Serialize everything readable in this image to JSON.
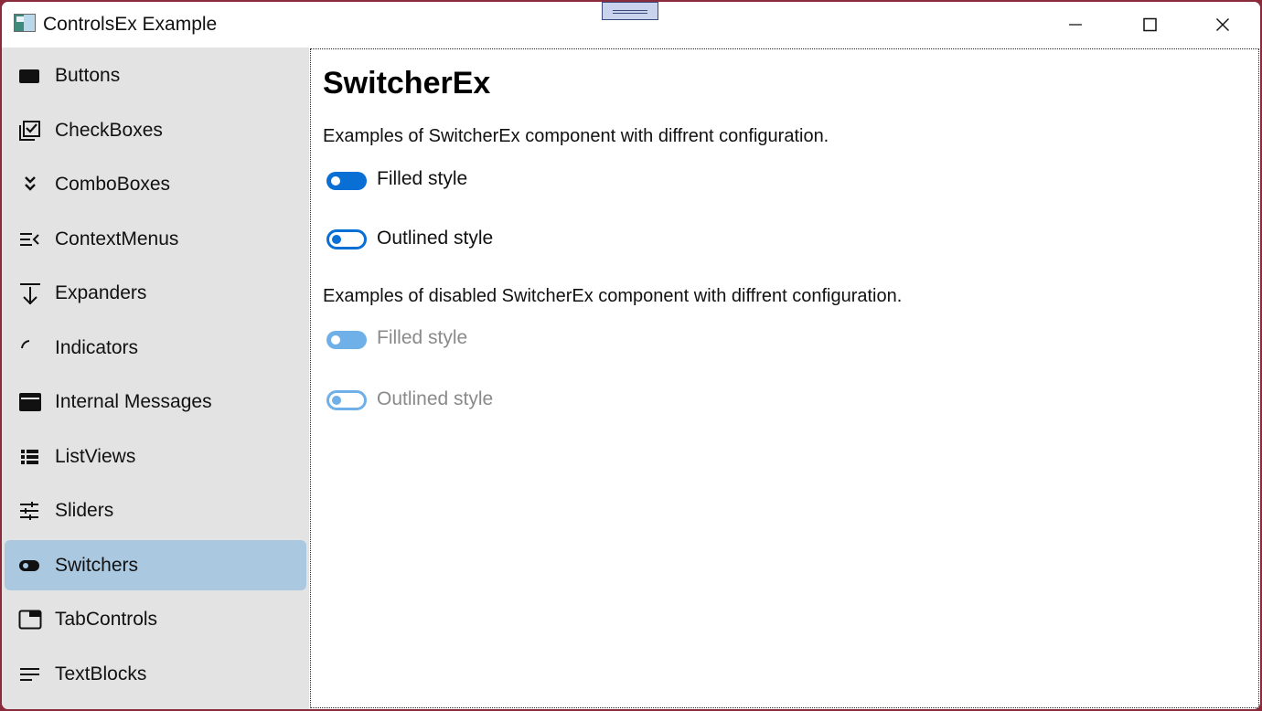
{
  "window": {
    "title": "ControlsEx Example"
  },
  "colors": {
    "accent": "#0a6fd4",
    "accent_disabled": "#6fb0e8",
    "sidebar_bg": "#e3e3e3",
    "selected_bg": "#abc8e1",
    "disabled_text": "#8a8a8a"
  },
  "sidebar": {
    "items": [
      {
        "label": "Buttons",
        "icon": "button-icon"
      },
      {
        "label": "CheckBoxes",
        "icon": "checkbox-multiple-icon"
      },
      {
        "label": "ComboBoxes",
        "icon": "chevron-double-down-icon"
      },
      {
        "label": "ContextMenus",
        "icon": "menu-open-icon"
      },
      {
        "label": "Expanders",
        "icon": "arrow-collapse-down-icon"
      },
      {
        "label": "Indicators",
        "icon": "progress-arc-icon"
      },
      {
        "label": "Internal Messages",
        "icon": "message-window-icon"
      },
      {
        "label": "ListViews",
        "icon": "list-view-icon"
      },
      {
        "label": "Sliders",
        "icon": "tune-sliders-icon"
      },
      {
        "label": "Switchers",
        "icon": "toggle-switch-icon",
        "selected": true
      },
      {
        "label": "TabControls",
        "icon": "tab-icon"
      },
      {
        "label": "TextBlocks",
        "icon": "text-lines-icon"
      }
    ]
  },
  "main": {
    "title": "SwitcherEx",
    "enabled_section": {
      "description": "Examples of SwitcherEx component with diffrent configuration.",
      "switches": [
        {
          "label": "Filled style",
          "style": "filled",
          "checked": false
        },
        {
          "label": "Outlined style",
          "style": "outlined",
          "checked": false
        }
      ]
    },
    "disabled_section": {
      "description": "Examples of disabled SwitcherEx component with diffrent configuration.",
      "switches": [
        {
          "label": "Filled style",
          "style": "filled",
          "checked": false
        },
        {
          "label": "Outlined style",
          "style": "outlined",
          "checked": false
        }
      ]
    }
  }
}
